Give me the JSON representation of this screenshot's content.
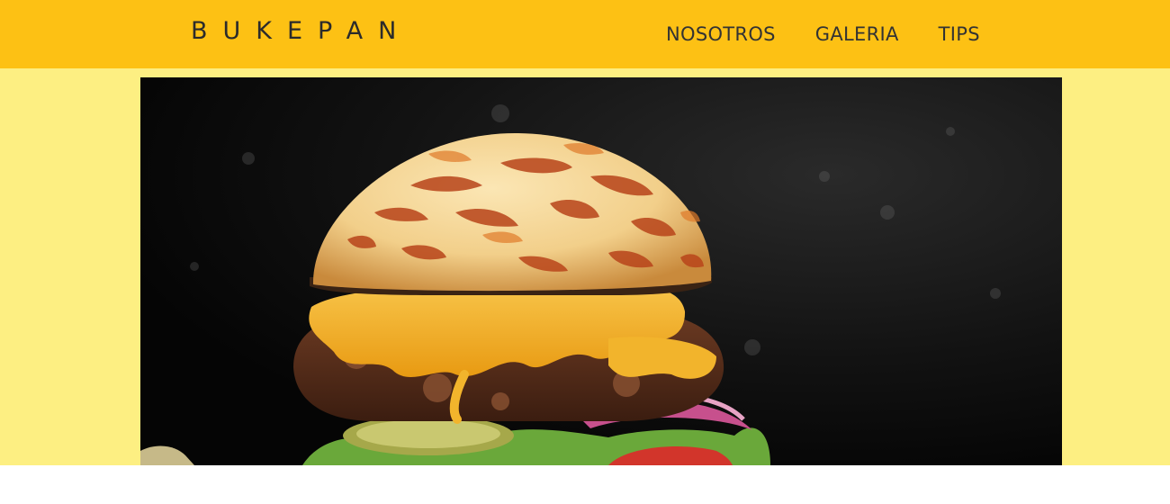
{
  "header": {
    "brand": "BUKEPAN",
    "nav": [
      {
        "label": "NOSOTROS"
      },
      {
        "label": "GALERIA"
      },
      {
        "label": "TIPS"
      }
    ]
  },
  "colors": {
    "header_bg": "#fdc114",
    "page_bg": "#fdef82",
    "hero_bg": "#0b0b0b",
    "text": "#333333"
  },
  "hero": {
    "image": "burger-photo"
  }
}
